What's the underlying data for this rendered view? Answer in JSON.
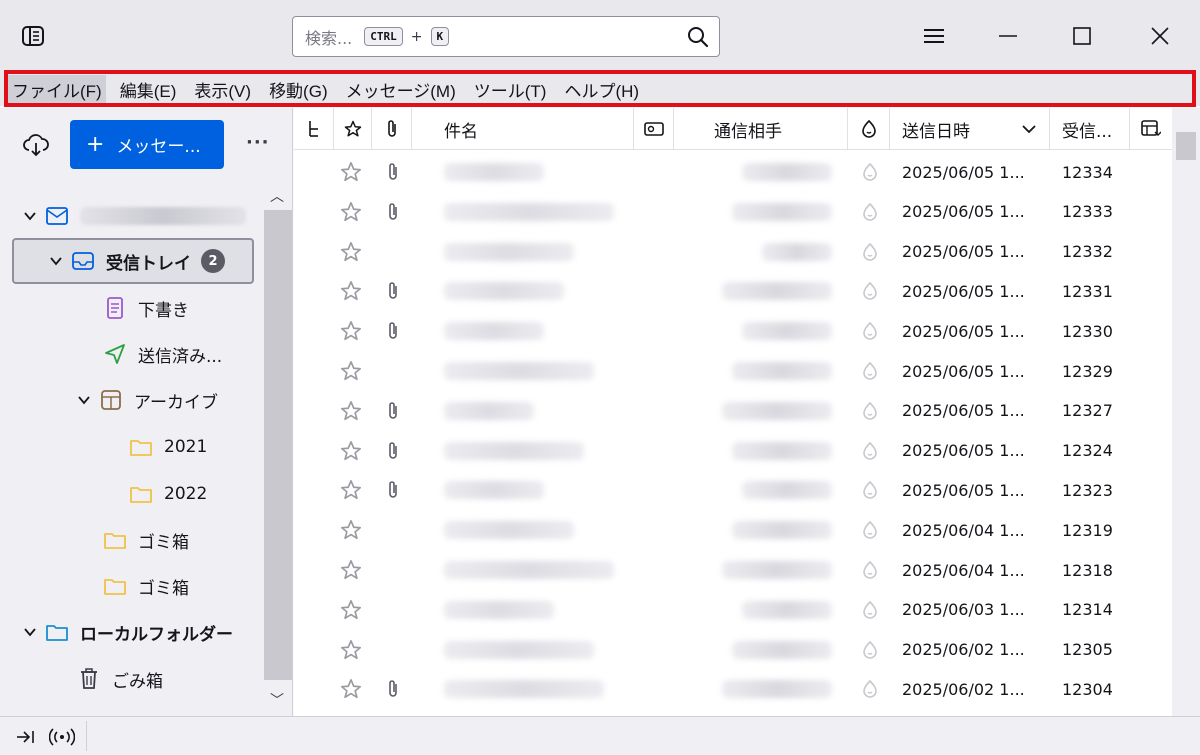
{
  "search": {
    "placeholder": "検索...",
    "shortcut_key1": "CTRL",
    "shortcut_plus": "+",
    "shortcut_key2": "K"
  },
  "menu": [
    {
      "label": "ファイル(F)",
      "active": true
    },
    {
      "label": "編集(E)"
    },
    {
      "label": "表示(V)"
    },
    {
      "label": "移動(G)"
    },
    {
      "label": "メッセージ(M)"
    },
    {
      "label": "ツール(T)"
    },
    {
      "label": "ヘルプ(H)"
    }
  ],
  "folder_pane": {
    "new_message_label": "メッセー...",
    "more_label": "···",
    "inbox": {
      "label": "受信トレイ",
      "unread": "2"
    },
    "folders": {
      "drafts": "下書き",
      "sent": "送信済み...",
      "archive": "アーカイブ",
      "y2021": "2021",
      "y2022": "2022",
      "trash1": "ゴミ箱",
      "trash2": "ゴミ箱",
      "local": "ローカルフォルダー",
      "local_trash": "ごみ箱"
    }
  },
  "columns": {
    "subject": "件名",
    "correspondent": "通信相手",
    "date": "送信日時",
    "received": "受信..."
  },
  "messages": [
    {
      "date": "2025/06/05 1...",
      "num": "12334",
      "attach": true,
      "subj_w": 100,
      "from_w": 90
    },
    {
      "date": "2025/06/05 1...",
      "num": "12333",
      "attach": true,
      "subj_w": 170,
      "from_w": 100
    },
    {
      "date": "2025/06/05 1...",
      "num": "12332",
      "attach": false,
      "subj_w": 130,
      "from_w": 70
    },
    {
      "date": "2025/06/05 1...",
      "num": "12331",
      "attach": true,
      "subj_w": 120,
      "from_w": 110
    },
    {
      "date": "2025/06/05 1...",
      "num": "12330",
      "attach": true,
      "subj_w": 100,
      "from_w": 90
    },
    {
      "date": "2025/06/05 1...",
      "num": "12329",
      "attach": false,
      "subj_w": 150,
      "from_w": 100
    },
    {
      "date": "2025/06/05 1...",
      "num": "12327",
      "attach": true,
      "subj_w": 90,
      "from_w": 110
    },
    {
      "date": "2025/06/05 1...",
      "num": "12324",
      "attach": true,
      "subj_w": 140,
      "from_w": 100
    },
    {
      "date": "2025/06/05 1...",
      "num": "12323",
      "attach": true,
      "subj_w": 100,
      "from_w": 90
    },
    {
      "date": "2025/06/04 1...",
      "num": "12319",
      "attach": false,
      "subj_w": 130,
      "from_w": 100
    },
    {
      "date": "2025/06/04 1...",
      "num": "12318",
      "attach": false,
      "subj_w": 170,
      "from_w": 110
    },
    {
      "date": "2025/06/03 1...",
      "num": "12314",
      "attach": false,
      "subj_w": 110,
      "from_w": 90
    },
    {
      "date": "2025/06/02 1...",
      "num": "12305",
      "attach": false,
      "subj_w": 150,
      "from_w": 100
    },
    {
      "date": "2025/06/02 1...",
      "num": "12304",
      "attach": true,
      "subj_w": 160,
      "from_w": 110
    }
  ],
  "colors": {
    "accent": "#0061e0",
    "highlight": "#e0101a",
    "folder": "#f0c24a",
    "sent": "#2ea043",
    "drafts": "#9b59d0",
    "inbox": "#0061e0"
  }
}
